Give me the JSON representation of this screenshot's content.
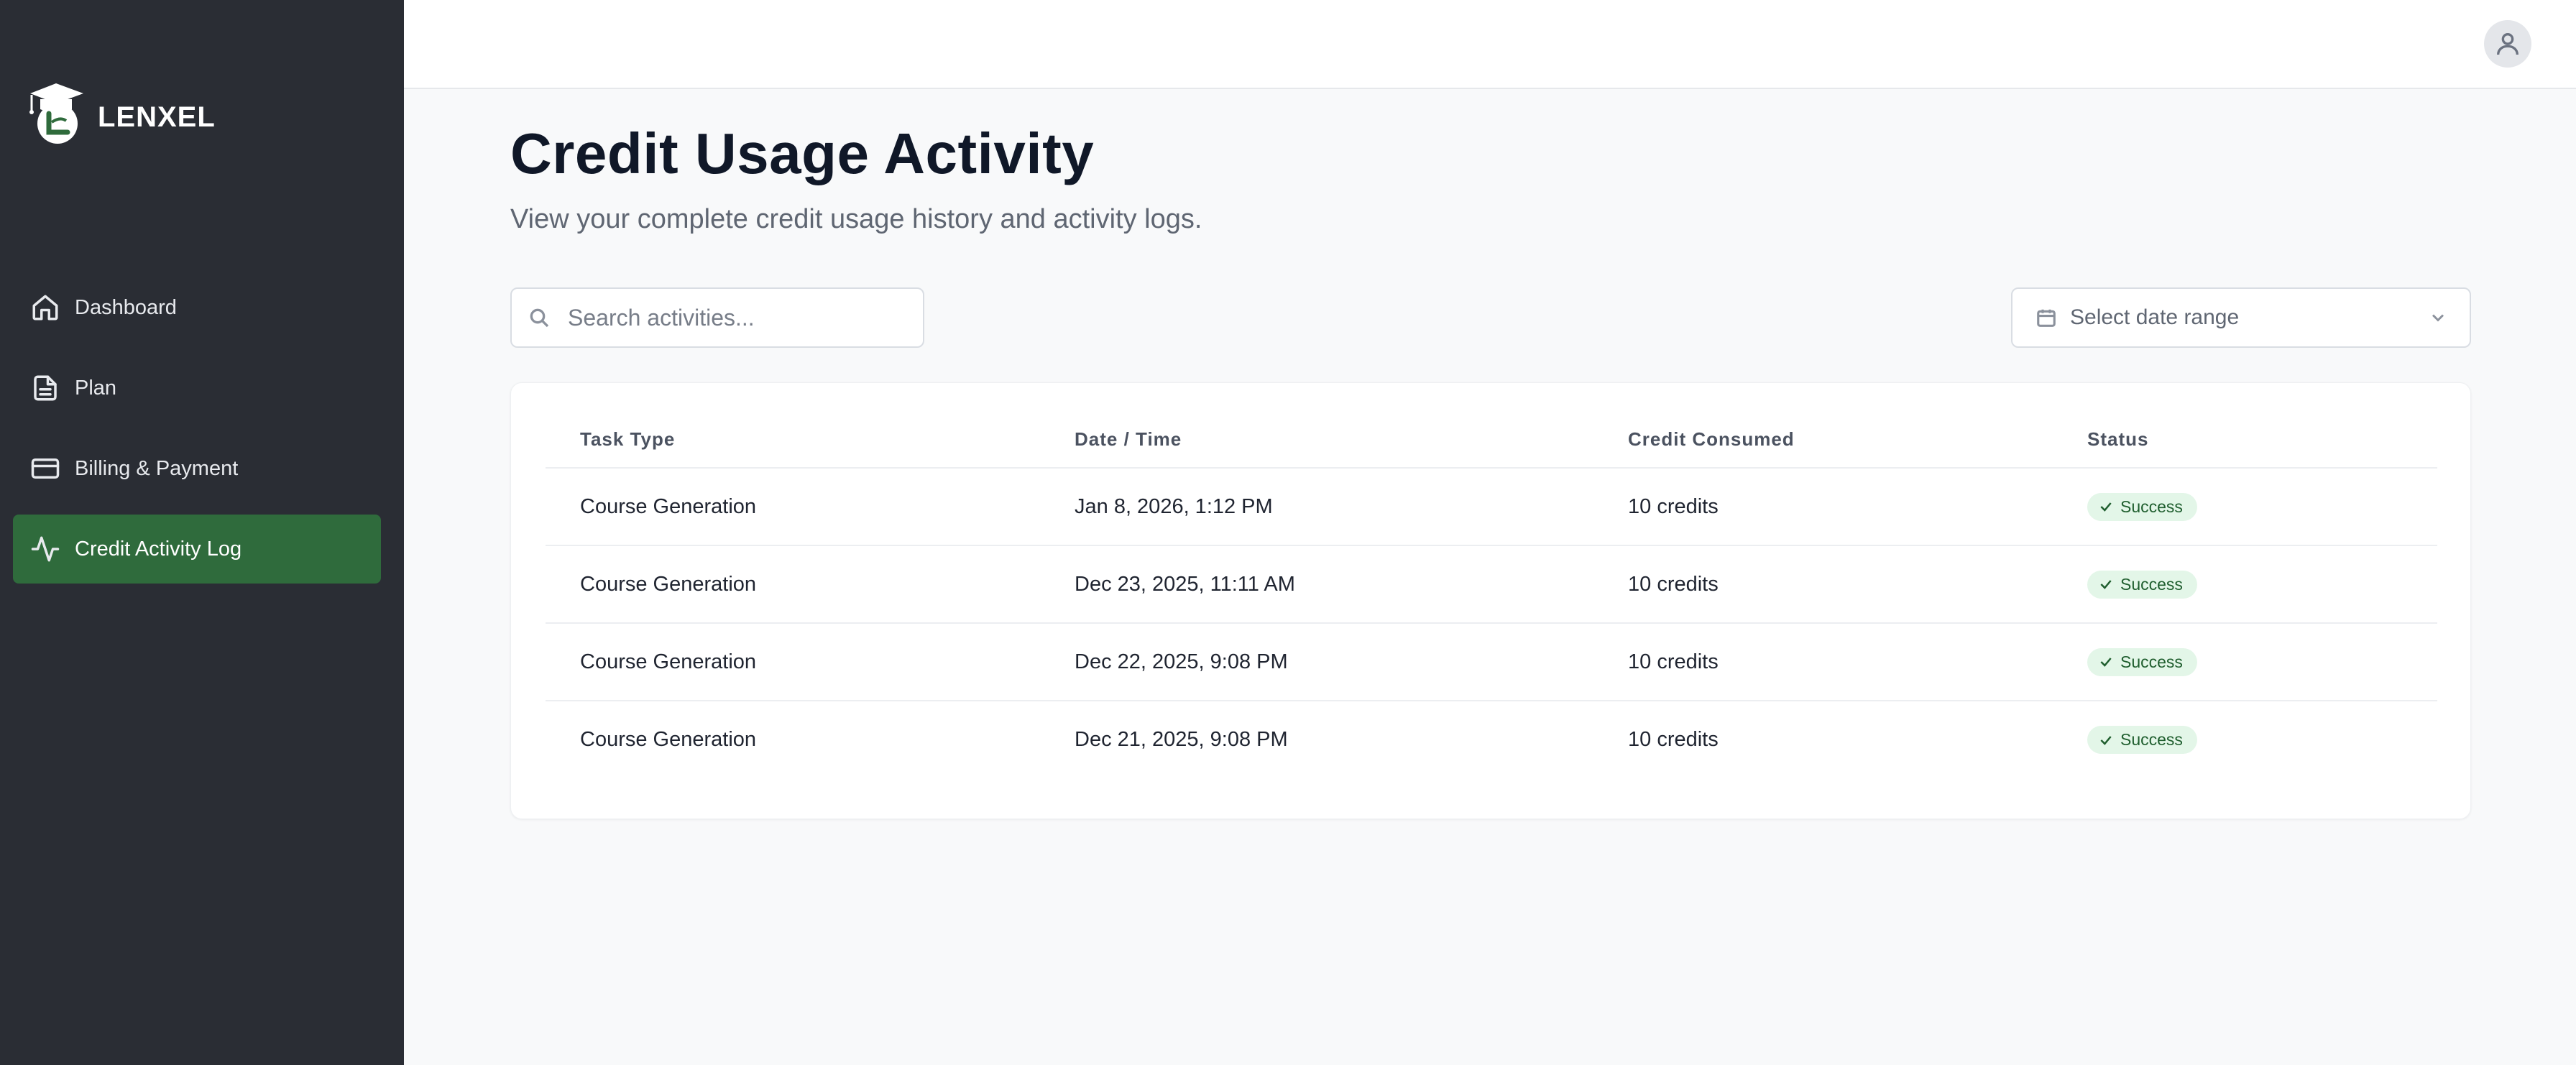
{
  "brand": {
    "name": "LENXEL"
  },
  "sidebar": {
    "items": [
      {
        "label": "Dashboard",
        "icon": "home-icon",
        "active": false
      },
      {
        "label": "Plan",
        "icon": "document-icon",
        "active": false
      },
      {
        "label": "Billing & Payment",
        "icon": "credit-card-icon",
        "active": false
      },
      {
        "label": "Credit Activity Log",
        "icon": "activity-icon",
        "active": true
      }
    ]
  },
  "header": {
    "avatar_icon": "user-icon"
  },
  "page": {
    "title": "Credit Usage Activity",
    "subtitle": "View your complete credit usage history and activity logs."
  },
  "filters": {
    "search_placeholder": "Search activities...",
    "date_range_label": "Select date range"
  },
  "table": {
    "headers": [
      "Task Type",
      "Date / Time",
      "Credit Consumed",
      "Status"
    ],
    "rows": [
      {
        "task": "Course Generation",
        "datetime": "Jan 8, 2026, 1:12 PM",
        "credits": "10 credits",
        "status": "Success"
      },
      {
        "task": "Course Generation",
        "datetime": "Dec 23, 2025, 11:11 AM",
        "credits": "10 credits",
        "status": "Success"
      },
      {
        "task": "Course Generation",
        "datetime": "Dec 22, 2025, 9:08 PM",
        "credits": "10 credits",
        "status": "Success"
      },
      {
        "task": "Course Generation",
        "datetime": "Dec 21, 2025, 9:08 PM",
        "credits": "10 credits",
        "status": "Success"
      }
    ]
  },
  "colors": {
    "sidebar_bg": "#2a2d34",
    "accent": "#2f6b3c",
    "success_bg": "#e3f6e8",
    "success_text": "#1f5e2e"
  }
}
